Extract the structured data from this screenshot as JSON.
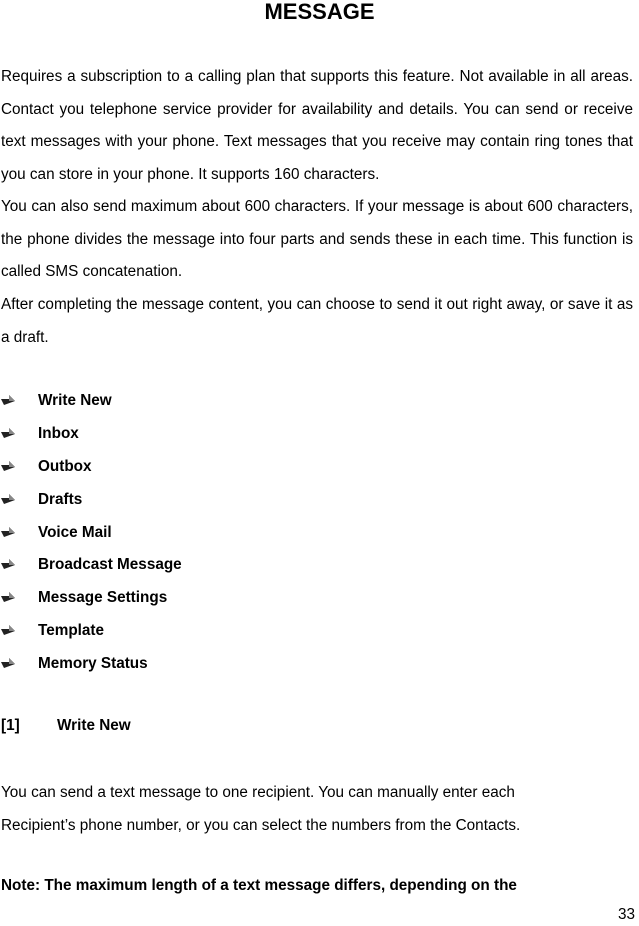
{
  "title": "MESSAGE",
  "paragraphs": [
    "Requires a subscription to a calling plan that supports this feature. Not available in all areas. Contact you telephone service provider for availability and details. You can send or receive text messages with your phone. Text messages that you receive may contain ring tones that you can store in your phone. It supports 160 characters.",
    "You can also send maximum about 600 characters. If your message is about 600 characters, the phone divides the message into four parts and sends these in each time. This function is called SMS concatenation.",
    "After completing the message content, you can choose to send it out right away, or save it as a draft."
  ],
  "menu_items": [
    {
      "label": "Write New",
      "icon": "arrow-bullet-icon"
    },
    {
      "label": "Inbox",
      "icon": "arrow-bullet-icon"
    },
    {
      "label": "Outbox",
      "icon": "arrow-bullet-icon"
    },
    {
      "label": "Drafts",
      "icon": "arrow-bullet-icon"
    },
    {
      "label": "Voice Mail",
      "icon": "arrow-bullet-icon"
    },
    {
      "label": "Broadcast Message",
      "icon": "arrow-bullet-icon"
    },
    {
      "label": "Message Settings",
      "icon": "arrow-bullet-icon"
    },
    {
      "label": "Template",
      "icon": "arrow-bullet-icon"
    },
    {
      "label": "Memory Status",
      "icon": "arrow-bullet-icon"
    }
  ],
  "section": {
    "number": "[1]",
    "heading": "Write New",
    "body_line1": "You can send a text message to one recipient. You can manually enter each",
    "body_line2": "Recipient’s phone number, or you can select the numbers from the Contacts."
  },
  "note": "Note: The maximum length of a text message differs, depending on the",
  "page_number": "33"
}
